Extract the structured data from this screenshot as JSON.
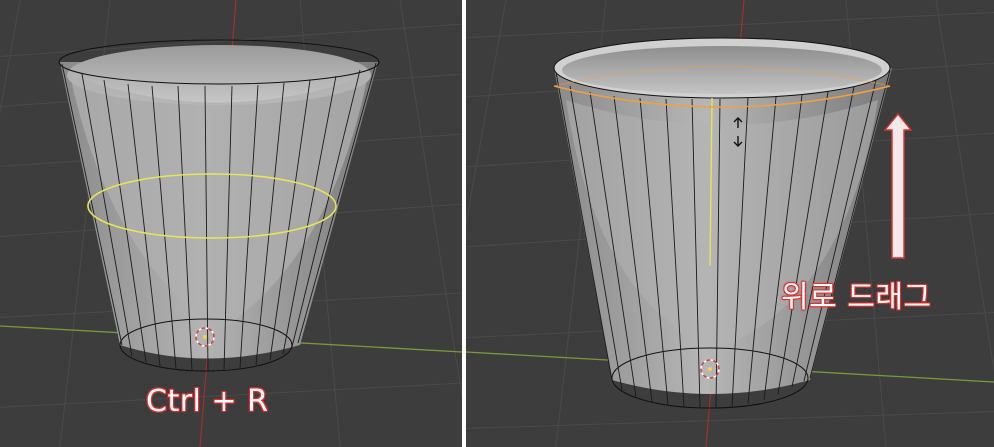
{
  "panels": [
    {
      "id": "left",
      "caption": "Ctrl + R",
      "loop_color": "#e6e45a",
      "highlight": "loop-cut-preview"
    },
    {
      "id": "right",
      "caption": "위로 드래그",
      "loop_color": "#f0a040",
      "highlight": "edge-slide-loop"
    }
  ],
  "colors": {
    "viewport_bg": "#3d3d3d",
    "grid": "#4a4a4a",
    "x_axis": "#7a9a3a",
    "z_axis": "#a03030",
    "wire": "#111111",
    "caption_outline": "#e03030",
    "arrow": "#f0e0e0"
  },
  "icons": {
    "cursor": "3d-cursor-icon",
    "slide": "up-down-arrows-icon",
    "drag": "up-arrow-icon"
  }
}
